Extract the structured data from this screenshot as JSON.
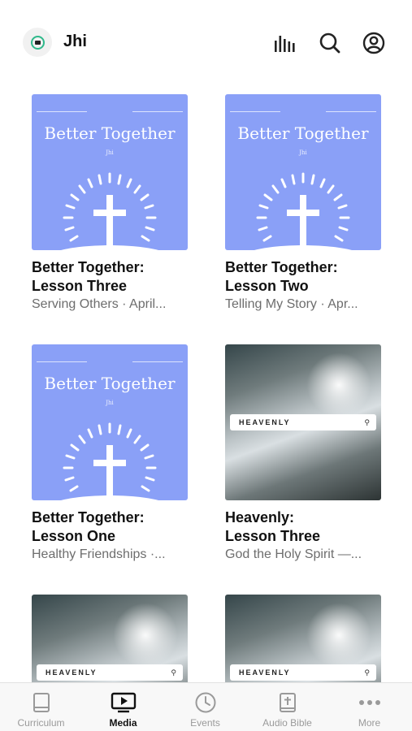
{
  "header": {
    "title": "Jhi",
    "logo_icon": "app-logo-icon",
    "icons": [
      "audio-bars-icon",
      "search-icon",
      "account-icon"
    ]
  },
  "media": {
    "items": [
      {
        "title_line1": "Better Together:",
        "title_line2": "Lesson Three",
        "subtitle": "Serving Others · April...",
        "thumb_type": "better-together",
        "thumb_title": "Better Together",
        "thumb_sub": "Jhi"
      },
      {
        "title_line1": "Better Together:",
        "title_line2": "Lesson Two",
        "subtitle": "Telling My Story · Apr...",
        "thumb_type": "better-together",
        "thumb_title": "Better Together",
        "thumb_sub": "Jhi"
      },
      {
        "title_line1": "Better Together:",
        "title_line2": "Lesson One",
        "subtitle": "Healthy Friendships ·...",
        "thumb_type": "better-together",
        "thumb_title": "Better Together",
        "thumb_sub": "Jhi"
      },
      {
        "title_line1": "Heavenly:",
        "title_line2": "Lesson Three",
        "subtitle": "God the Holy Spirit —...",
        "thumb_type": "heavenly",
        "thumb_bar": "HEAVENLY"
      },
      {
        "thumb_type": "heavenly",
        "thumb_bar": "HEAVENLY"
      },
      {
        "thumb_type": "heavenly",
        "thumb_bar": "HEAVENLY"
      }
    ]
  },
  "tabbar": {
    "tabs": [
      {
        "label": "Curriculum",
        "icon": "book-icon",
        "active": false
      },
      {
        "label": "Media",
        "icon": "play-screen-icon",
        "active": true
      },
      {
        "label": "Events",
        "icon": "clock-icon",
        "active": false
      },
      {
        "label": "Audio Bible",
        "icon": "bible-icon",
        "active": false
      },
      {
        "label": "More",
        "icon": "more-dots-icon",
        "active": false
      }
    ]
  },
  "colors": {
    "accent_green": "#2fb98b",
    "thumb_blue": "#8aa0f7",
    "text_primary": "#111111",
    "text_secondary": "#6d6d6d",
    "tab_inactive": "#9a9a9a"
  }
}
